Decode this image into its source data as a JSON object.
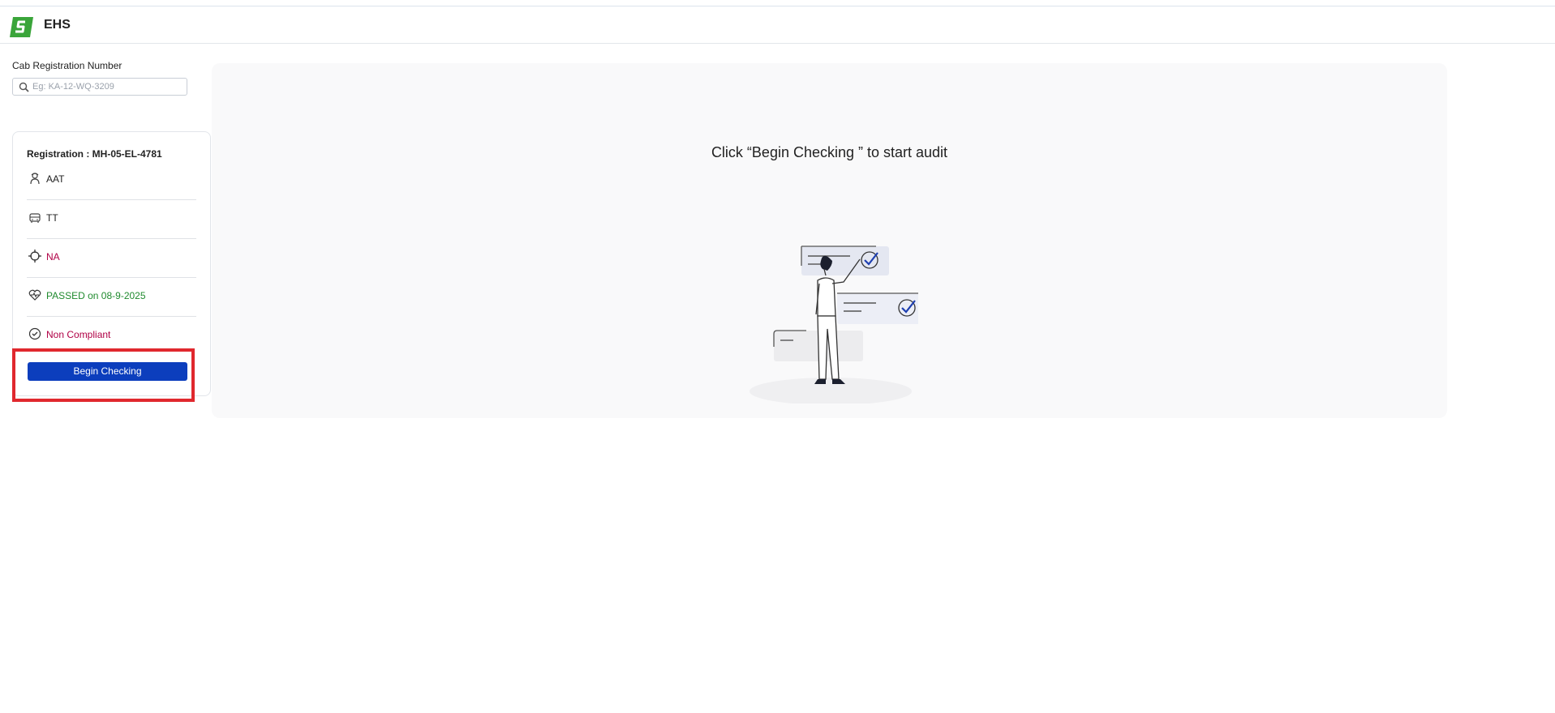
{
  "app": {
    "title": "EHS",
    "brand_color": "#3aa53a"
  },
  "search": {
    "label": "Cab Registration Number",
    "placeholder": "Eg: KA-12-WQ-3209",
    "value": ""
  },
  "vehicle": {
    "registration": "Registration : MH-05-EL-4781",
    "rows": [
      {
        "icon": "driver-icon",
        "text": "AAT",
        "status": "normal"
      },
      {
        "icon": "cab-icon",
        "text": "TT",
        "status": "normal"
      },
      {
        "icon": "location-target-icon",
        "text": "NA",
        "status": "error"
      },
      {
        "icon": "health-heart-icon",
        "text": "PASSED on 08-9-2025",
        "status": "success"
      },
      {
        "icon": "check-circle-icon",
        "text": "Non Compliant",
        "status": "error"
      }
    ],
    "begin_label": "Begin Checking"
  },
  "main": {
    "message": "Click “Begin Checking ” to start audit"
  },
  "colors": {
    "primary": "#0c3ebd",
    "error": "#b00045",
    "success": "#1f8a2e",
    "highlight": "#e0282e"
  }
}
